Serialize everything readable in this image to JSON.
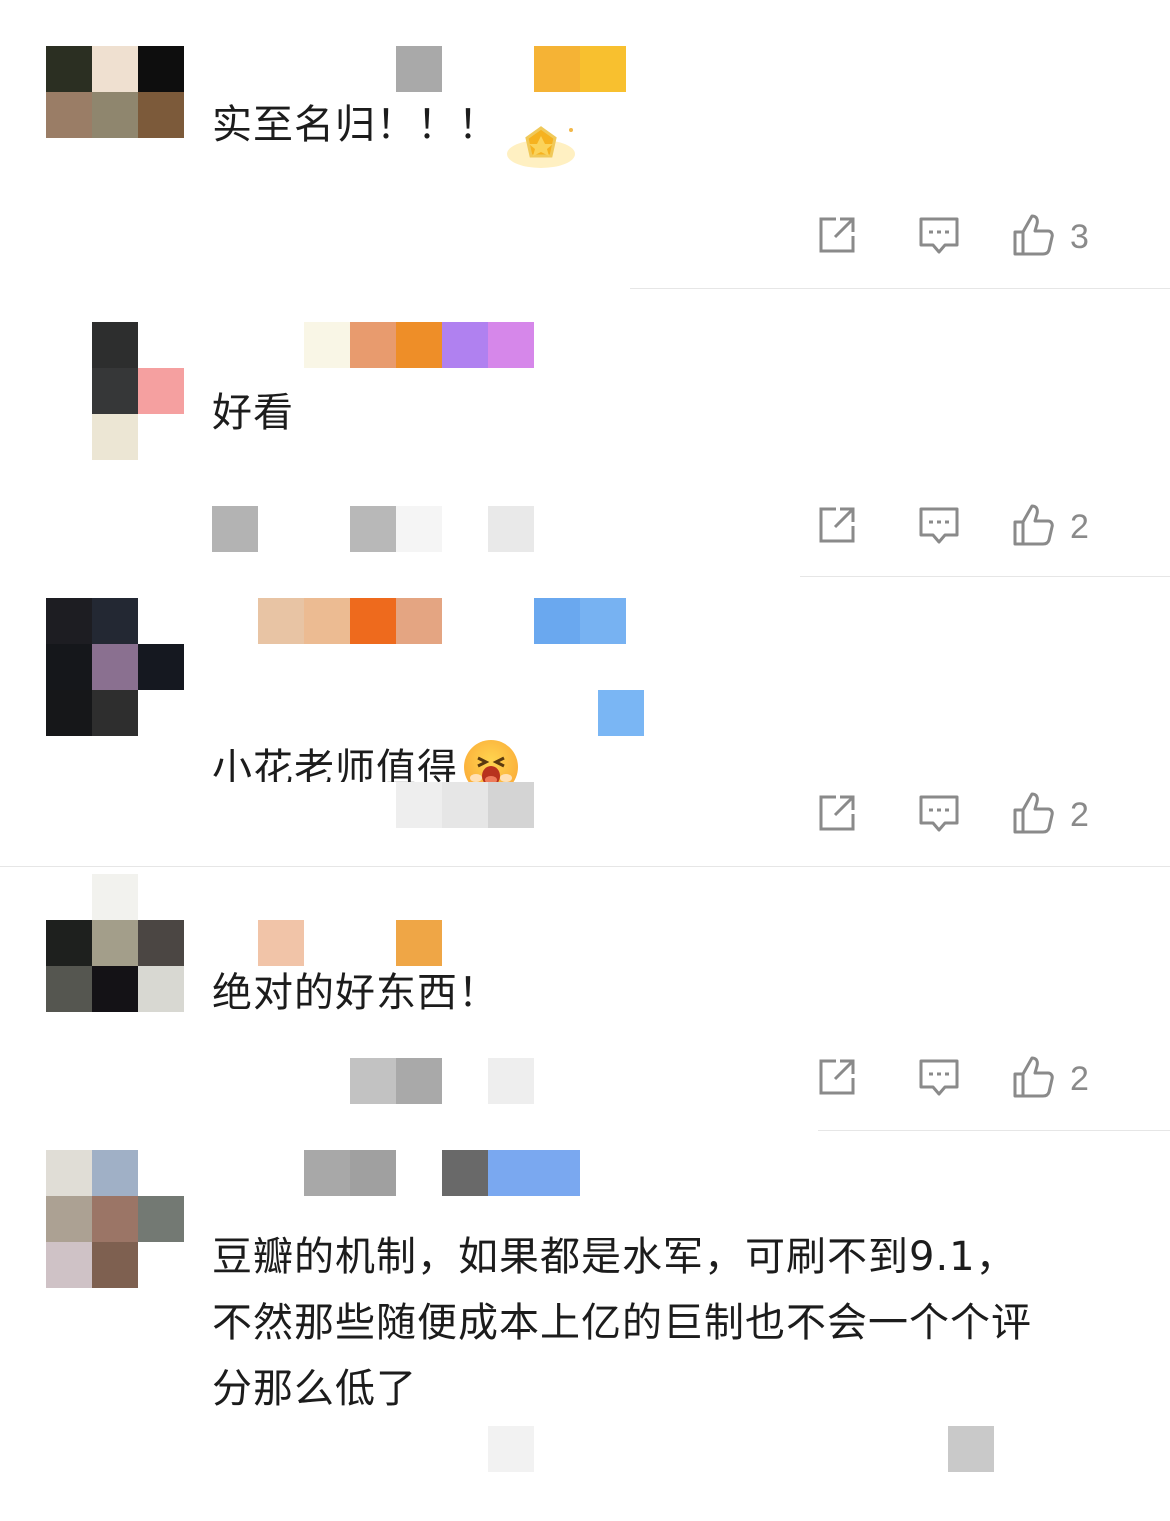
{
  "colors": {
    "like_count": "#8a8a8a",
    "icon_stroke": "#8a8a8a",
    "divider": "#e6e6e6"
  },
  "icons": {
    "share": "share-icon",
    "reply": "comment-icon",
    "like": "thumbs-up-icon"
  },
  "comments": [
    {
      "text": "实至名归！！！",
      "likes": "3",
      "avatar": [
        "#2b2f22",
        "#efe0d0",
        "#0e0e0e",
        "#9a7d66",
        "#8f866e",
        "#7c5a3a",
        "#ffffff",
        "#ffffff",
        "#ffffff"
      ],
      "name": [
        "#ffffff",
        "#ffffff",
        "#ffffff",
        "#ffffff",
        "#a9a9a9",
        "#ffffff",
        "#ffffff",
        "#f5b335",
        "#f8c02f"
      ],
      "has_badge": true
    },
    {
      "text": "好看",
      "likes": "2",
      "avatar": [
        "#ffffff",
        "#2d2e2e",
        "#ffffff",
        "#ffffff",
        "#363738",
        "#f5a0a0",
        "#ffffff",
        "#ece6d4",
        "#ffffff"
      ],
      "name": [
        "#ffffff",
        "#ffffff",
        "#f9f6e6",
        "#e89b6e",
        "#ee8e28",
        "#b081f0",
        "#d687ea"
      ],
      "meta": [
        "#b3b3b3",
        "#ffffff",
        "#ffffff",
        "#b8b8b8",
        "#f5f5f5",
        "#ffffff",
        "#e9e9e9"
      ]
    },
    {
      "text": "小花老师值得",
      "likes": "2",
      "avatar": [
        "#1d1d22",
        "#232833",
        "#ffffff",
        "#15171b",
        "#8a7090",
        "#151820",
        "#161719",
        "#2e2e2e",
        "#ffffff"
      ],
      "name": [
        "#ffffff",
        "#e8c4a4",
        "#ecbb92",
        "#ee6a1d",
        "#e4a582",
        "#ffffff",
        "#ffffff",
        "#6aa8ef",
        "#77b2f2"
      ],
      "meta": [
        "#ffffff",
        "#ffffff",
        "#ffffff",
        "#ffffff",
        "#eeeeee",
        "#e6e6e6",
        "#d4d4d4"
      ],
      "has_emoji": true
    },
    {
      "text": "绝对的好东西！",
      "likes": "2",
      "avatar": [
        "#ffffff",
        "#f2f2ee",
        "#ffffff",
        "#1e201e",
        "#a39e8a",
        "#4b4643",
        "#555650",
        "#141216",
        "#d8d8d2"
      ],
      "name": [
        "#ffffff",
        "#f1c4a8",
        "#ffffff",
        "#ffffff",
        "#efa646"
      ],
      "meta": [
        "#ffffff",
        "#ffffff",
        "#ffffff",
        "#c2c2c2",
        "#a9a9a9",
        "#ffffff",
        "#eeeeee"
      ]
    },
    {
      "text": "豆瓣的机制，如果都是水军，可刷不到9.1，\n不然那些随便成本上亿的巨制也不会一个个评\n分那么低了",
      "avatar": [
        "#e0ddd6",
        "#a0b0c6",
        "#ffffff",
        "#aca193",
        "#9b7566",
        "#737973",
        "#cfc2c6",
        "#7e6050",
        "#ffffff"
      ],
      "name": [
        "#ffffff",
        "#ffffff",
        "#a8a8a8",
        "#a0a0a0",
        "#ffffff",
        "#696969",
        "#7aa8f0",
        "#7aa8f0"
      ],
      "meta": [
        "#ffffff",
        "#ffffff",
        "#ffffff",
        "#ffffff",
        "#ffffff",
        "#ffffff",
        "#f2f2f2",
        "#ffffff",
        "#ffffff",
        "#ffffff",
        "#ffffff",
        "#ffffff",
        "#ffffff",
        "#ffffff",
        "#ffffff",
        "#ffffff",
        "#c9c9c9"
      ]
    }
  ]
}
